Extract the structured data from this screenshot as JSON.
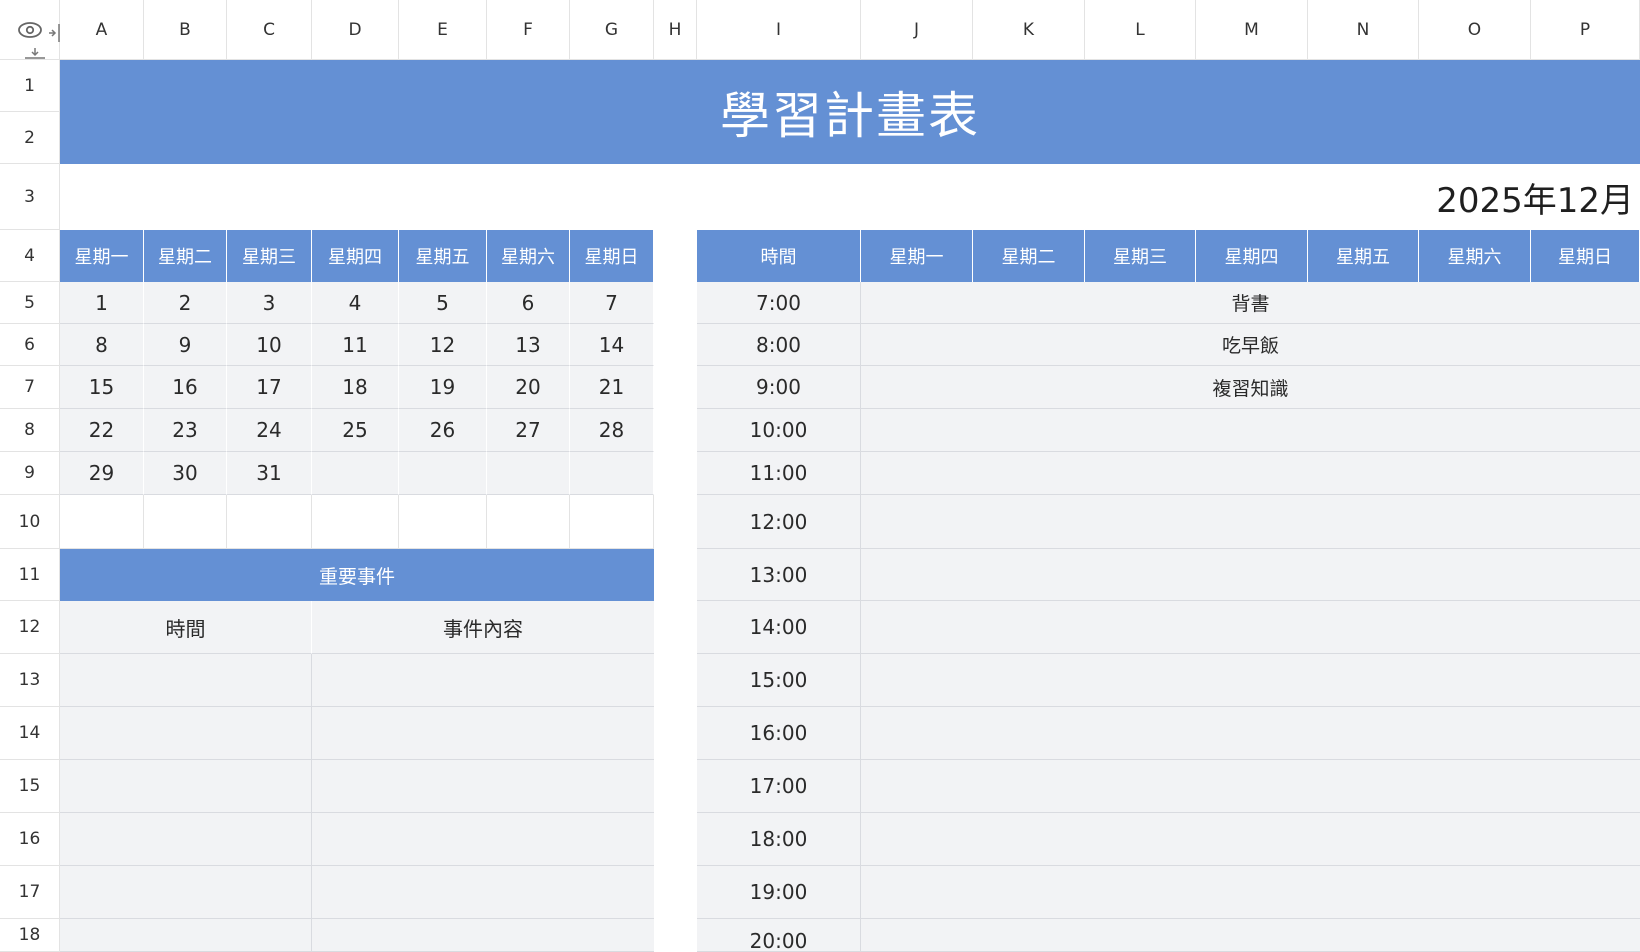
{
  "columns": [
    "A",
    "B",
    "C",
    "D",
    "E",
    "F",
    "G",
    "H",
    "I",
    "J",
    "K",
    "L",
    "M",
    "N",
    "O",
    "P"
  ],
  "rows": [
    "1",
    "2",
    "3",
    "4",
    "5",
    "6",
    "7",
    "8",
    "9",
    "10",
    "11",
    "12",
    "13",
    "14",
    "15",
    "16",
    "17",
    "18"
  ],
  "icons": {
    "visibility": "eye-icon",
    "freeze_columns": "freeze-columns-icon",
    "freeze_rows": "freeze-rows-icon"
  },
  "colors": {
    "header_blue": "#6490d4",
    "cell_grey": "#f2f3f5"
  },
  "title": "學習計畫表",
  "month_label": "2025年12月",
  "calendar": {
    "weekdays": [
      "星期一",
      "星期二",
      "星期三",
      "星期四",
      "星期五",
      "星期六",
      "星期日"
    ],
    "weeks": [
      [
        "1",
        "2",
        "3",
        "4",
        "5",
        "6",
        "7"
      ],
      [
        "8",
        "9",
        "10",
        "11",
        "12",
        "13",
        "14"
      ],
      [
        "15",
        "16",
        "17",
        "18",
        "19",
        "20",
        "21"
      ],
      [
        "22",
        "23",
        "24",
        "25",
        "26",
        "27",
        "28"
      ],
      [
        "29",
        "30",
        "31",
        "",
        "",
        "",
        ""
      ]
    ]
  },
  "events": {
    "title": "重要事件",
    "col_time": "時間",
    "col_content": "事件內容"
  },
  "schedule": {
    "time_header": "時間",
    "weekdays": [
      "星期一",
      "星期二",
      "星期三",
      "星期四",
      "星期五",
      "星期六",
      "星期日"
    ],
    "slots": [
      {
        "time": "7:00",
        "activity": "背書"
      },
      {
        "time": "8:00",
        "activity": "吃早飯"
      },
      {
        "time": "9:00",
        "activity": "複習知識"
      },
      {
        "time": "10:00",
        "activity": ""
      },
      {
        "time": "11:00",
        "activity": ""
      },
      {
        "time": "12:00",
        "activity": ""
      },
      {
        "time": "13:00",
        "activity": ""
      },
      {
        "time": "14:00",
        "activity": ""
      },
      {
        "time": "15:00",
        "activity": ""
      },
      {
        "time": "16:00",
        "activity": ""
      },
      {
        "time": "17:00",
        "activity": ""
      },
      {
        "time": "18:00",
        "activity": ""
      },
      {
        "time": "19:00",
        "activity": ""
      },
      {
        "time": "20:00",
        "activity": ""
      }
    ]
  }
}
